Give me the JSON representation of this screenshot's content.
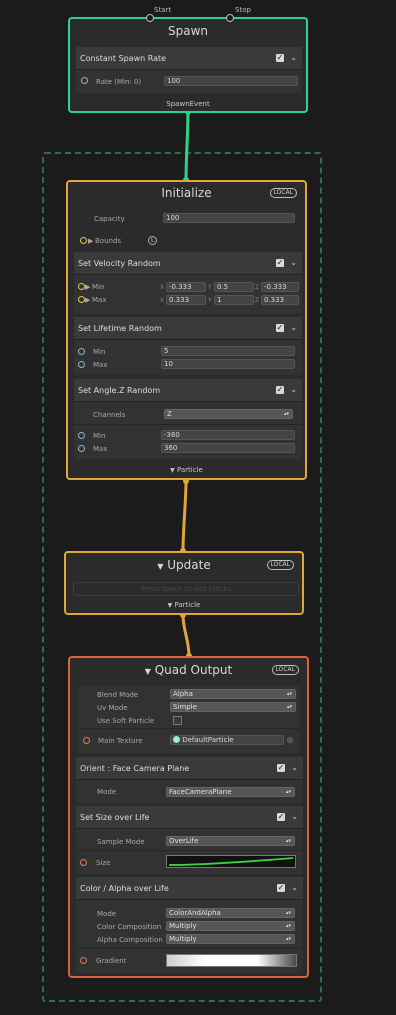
{
  "spawn": {
    "title": "Spawn",
    "start_label": "Start",
    "stop_label": "Stop",
    "event_label": "SpawnEvent",
    "block": {
      "title": "Constant Spawn Rate",
      "rate_label": "Rate (Min: 0)",
      "rate_value": "100"
    }
  },
  "initialize": {
    "title": "Initialize",
    "badge": "LOCAL",
    "capacity_label": "Capacity",
    "capacity_value": "100",
    "bounds_label": "Bounds",
    "bounds_badge": "L",
    "output_label": "Particle",
    "velocity": {
      "title": "Set Velocity Random",
      "min_label": "Min",
      "max_label": "Max",
      "x": "X",
      "y": "Y",
      "z": "Z",
      "min": [
        "-0.333",
        "0.5",
        "-0.333"
      ],
      "max": [
        "0.333",
        "1",
        "0.333"
      ]
    },
    "lifetime": {
      "title": "Set Lifetime Random",
      "min_label": "Min",
      "max_label": "Max",
      "min": "5",
      "max": "10"
    },
    "angle": {
      "title": "Set Angle.Z Random",
      "channels_label": "Channels",
      "channels_value": "Z",
      "min_label": "Min",
      "max_label": "Max",
      "min": "-360",
      "max": "360"
    }
  },
  "update": {
    "title": "Update",
    "badge": "LOCAL",
    "placeholder": "Press space to add blocks",
    "output_label": "Particle"
  },
  "output": {
    "title": "Quad Output",
    "badge": "LOCAL",
    "blend_mode_label": "Blend Mode",
    "blend_mode_value": "Alpha",
    "uv_mode_label": "Uv Mode",
    "uv_mode_value": "Simple",
    "soft_particle_label": "Use Soft Particle",
    "main_texture_label": "Main Texture",
    "main_texture_value": "DefaultParticle",
    "orient": {
      "title": "Orient : Face Camera Plane",
      "mode_label": "Mode",
      "mode_value": "FaceCameraPlane"
    },
    "size": {
      "title": "Set Size over Life",
      "sample_mode_label": "Sample Mode",
      "sample_mode_value": "OverLife",
      "size_label": "Size"
    },
    "color": {
      "title": "Color / Alpha over Life",
      "mode_label": "Mode",
      "mode_value": "ColorAndAlpha",
      "color_comp_label": "Color Composition",
      "color_comp_value": "Multiply",
      "alpha_comp_label": "Alpha Composition",
      "alpha_comp_value": "Multiply",
      "gradient_label": "Gradient"
    }
  },
  "colors": {
    "spawn_border": "#2bd48a",
    "init_border": "#e2a53a",
    "output_border": "#d9623d",
    "curve": "#3fd23f",
    "system_border": "#2f6b4e"
  }
}
